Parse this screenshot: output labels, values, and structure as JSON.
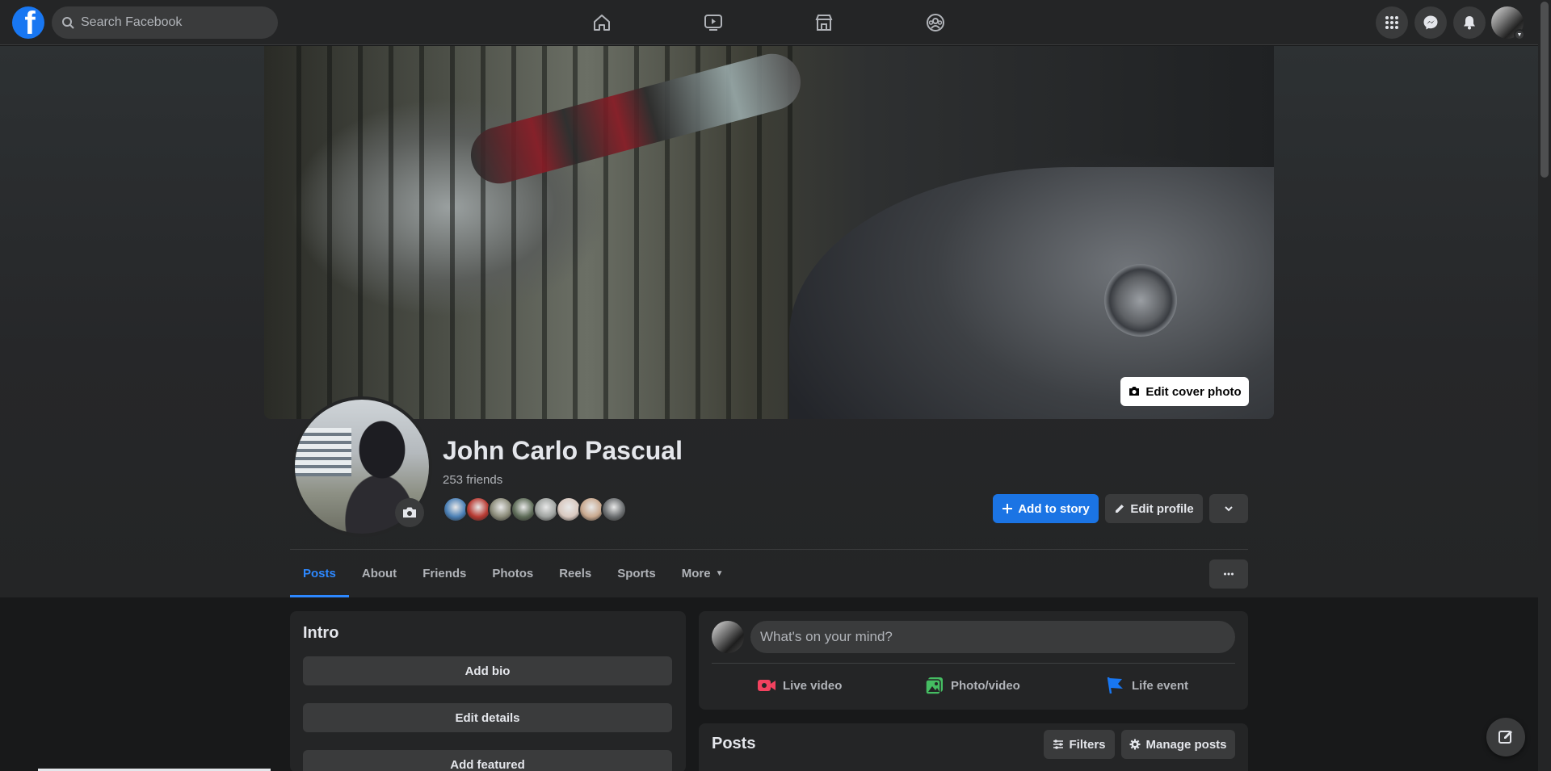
{
  "topbar": {
    "logo_letter": "f",
    "search_placeholder": "Search Facebook",
    "nav": [
      "home-icon",
      "watch-icon",
      "marketplace-icon",
      "groups-icon"
    ],
    "right": [
      "menu-grid-icon",
      "messenger-icon",
      "notifications-icon",
      "account-avatar"
    ]
  },
  "cover": {
    "edit_label": "Edit cover photo"
  },
  "profile": {
    "name": "John Carlo Pascual",
    "friends_count": "253 friends",
    "friend_avatar_colors": [
      "#4a7fb5",
      "#b83a32",
      "#8c8c7a",
      "#5f6d59",
      "#9fa3a0",
      "#d9c9c0",
      "#c9a98f",
      "#6b6e70"
    ]
  },
  "actions": {
    "add_to_story": "Add to story",
    "edit_profile": "Edit profile"
  },
  "tabs": [
    {
      "label": "Posts",
      "active": true
    },
    {
      "label": "About"
    },
    {
      "label": "Friends"
    },
    {
      "label": "Photos"
    },
    {
      "label": "Reels"
    },
    {
      "label": "Sports"
    },
    {
      "label": "More"
    }
  ],
  "intro": {
    "title": "Intro",
    "add_bio": "Add bio",
    "edit_details": "Edit details",
    "add_featured": "Add featured"
  },
  "composer": {
    "placeholder": "What's on your mind?",
    "live_video": "Live video",
    "photo_video": "Photo/video",
    "life_event": "Life event"
  },
  "posts": {
    "title": "Posts",
    "filters": "Filters",
    "manage_posts": "Manage posts"
  },
  "colors": {
    "accent": "#2d88ff",
    "primary_button": "#1b74e4",
    "live_video": "#f3425f",
    "photo_video": "#45bd62",
    "life_event": "#1877f2"
  }
}
